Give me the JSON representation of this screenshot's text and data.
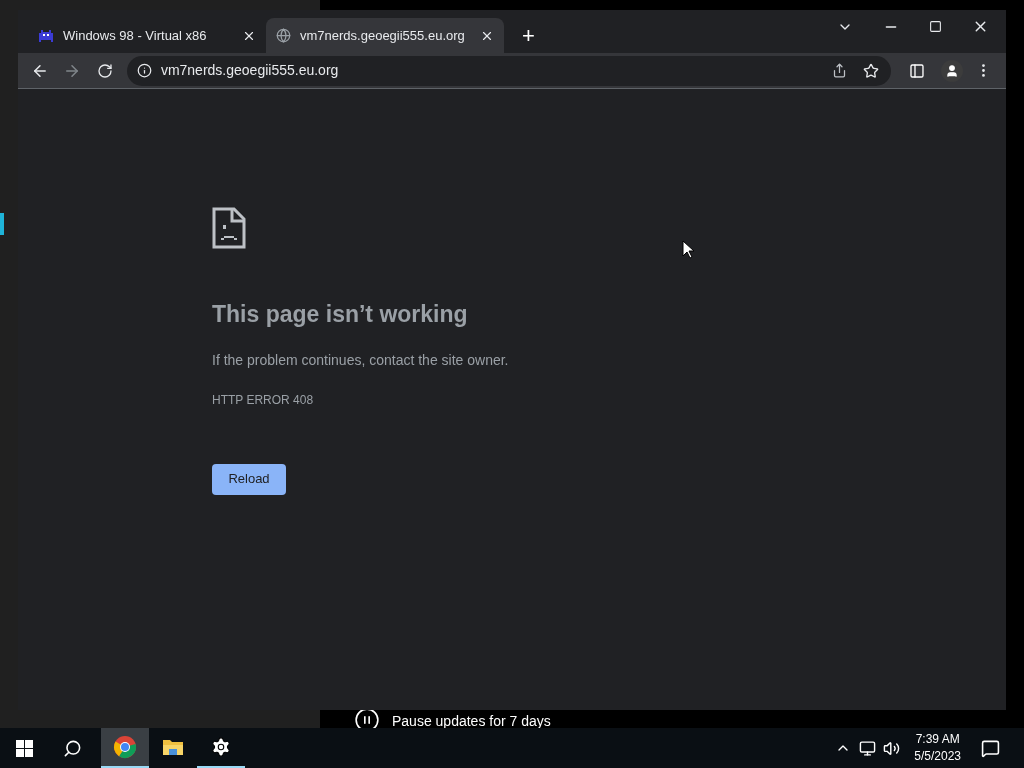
{
  "browser": {
    "tabs": [
      {
        "kind": "app",
        "title": "Windows 98 - Virtual x86",
        "selected": false
      },
      {
        "kind": "globe",
        "title": "vm7nerds.geoegii555.eu.org",
        "selected": true
      }
    ],
    "new_tab": "+",
    "address": "vm7nerds.geoegii555.eu.org"
  },
  "error_page": {
    "title": "This page isn’t working",
    "message": "If the problem continues, contact the site owner.",
    "code": "HTTP ERROR 408",
    "button": "Reload"
  },
  "background_window": {
    "notice": "Pause updates for 7 days"
  },
  "taskbar": {
    "apps": [
      {
        "kind": "browser",
        "open": true,
        "selected": true
      },
      {
        "kind": "folder",
        "open": false,
        "selected": false
      },
      {
        "kind": "gear",
        "open": true,
        "selected": false
      }
    ],
    "time": "7:39 AM",
    "date": "5/5/2023"
  }
}
